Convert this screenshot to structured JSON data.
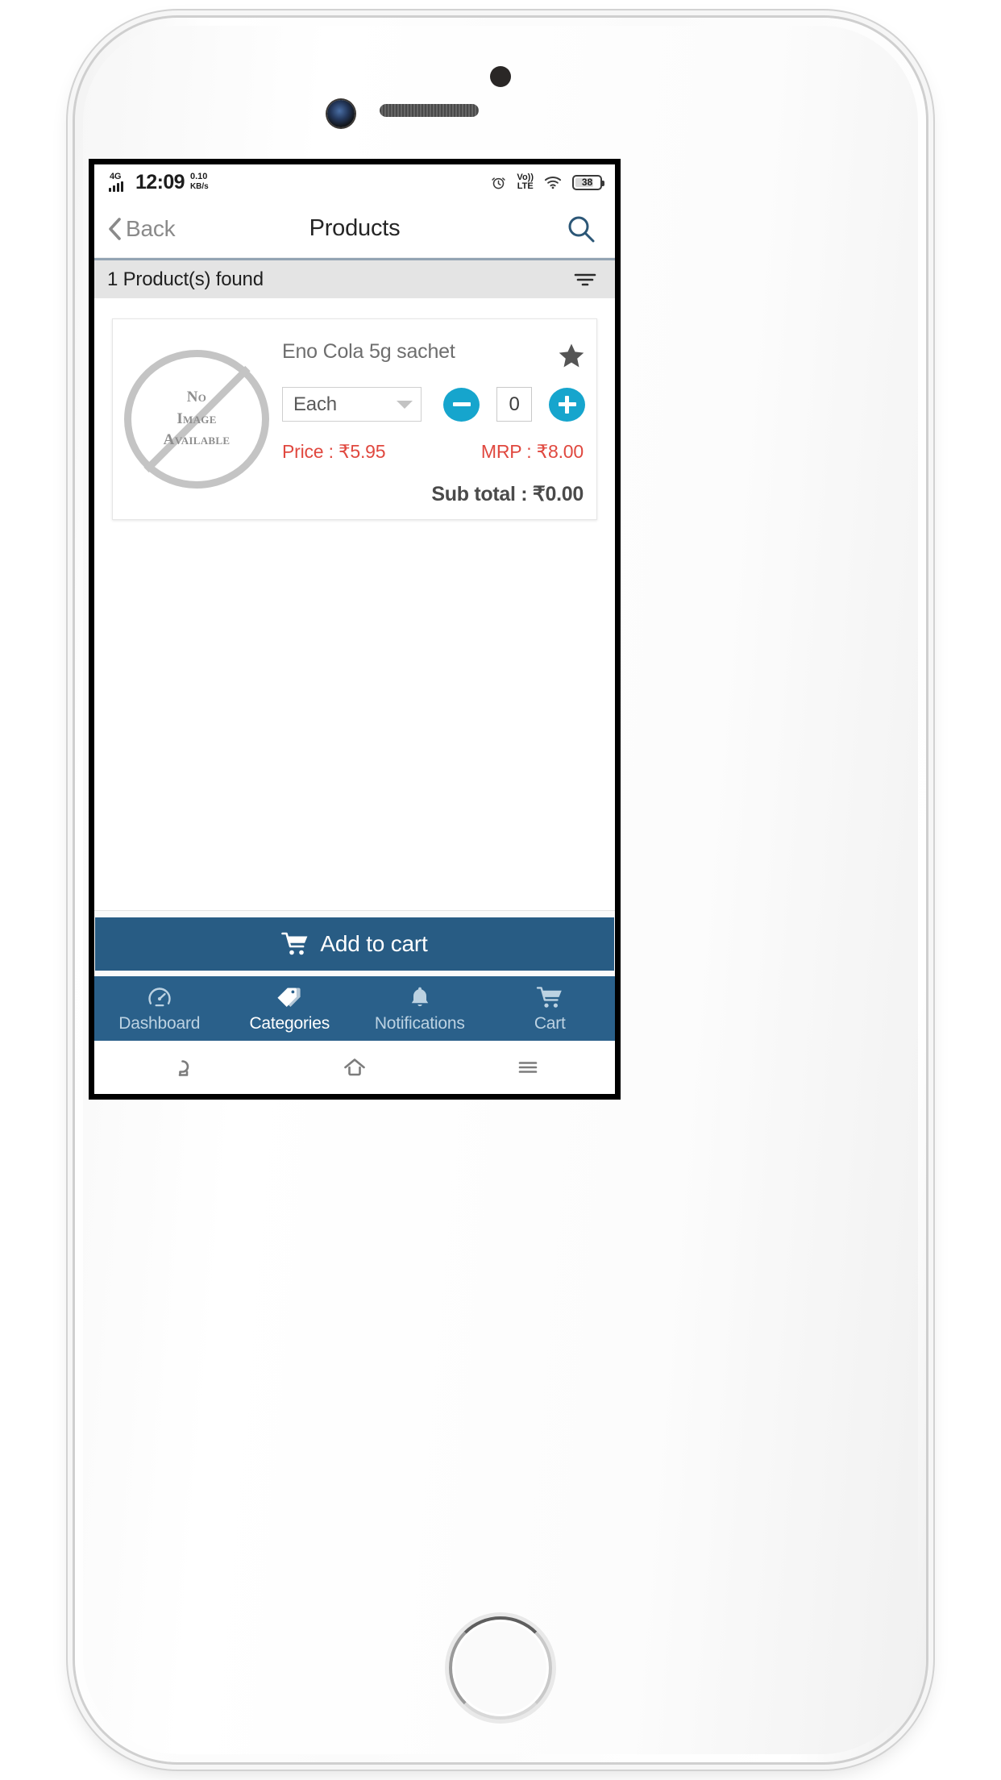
{
  "status_bar": {
    "network_type": "4G",
    "time": "12:09",
    "net_speed_value": "0.10",
    "net_speed_unit": "KB/s",
    "alarm_icon": "alarm-clock-icon",
    "volte_line1": "Vo))",
    "volte_line2": "LTE",
    "wifi_icon": "wifi-icon",
    "battery_level": "38"
  },
  "header": {
    "back_label": "Back",
    "title": "Products",
    "search_icon": "search-icon",
    "search_icon_color": "#2c5777"
  },
  "filter_bar": {
    "results_text": "1 Product(s) found",
    "filter_icon": "filter-icon"
  },
  "product": {
    "image_placeholder_line1": "No",
    "image_placeholder_line2": "Image",
    "image_placeholder_line3": "Available",
    "name": "Eno Cola 5g sachet",
    "favorite_icon": "star-filled-icon",
    "unit": "Each",
    "decrement_icon": "minus-icon",
    "quantity": "0",
    "increment_icon": "plus-icon",
    "price_label": "Price : ₹5.95",
    "mrp_label": "MRP : ₹8.00",
    "subtotal_label": "Sub total : ₹0.00",
    "price_color": "#e0483f",
    "stepper_color": "#16a5cd"
  },
  "add_to_cart": {
    "label": "Add to cart",
    "icon": "shopping-cart-icon",
    "color": "#285c84"
  },
  "bottom_nav": {
    "items": [
      {
        "label": "Dashboard",
        "icon": "speedometer-icon",
        "active": false
      },
      {
        "label": "Categories",
        "icon": "tags-icon",
        "active": true
      },
      {
        "label": "Notifications",
        "icon": "bell-icon",
        "active": false
      },
      {
        "label": "Cart",
        "icon": "shopping-cart-icon",
        "active": false
      }
    ]
  },
  "system_nav": {
    "back_icon": "android-back-icon",
    "home_icon": "android-home-icon",
    "recents_icon": "android-menu-icon"
  }
}
